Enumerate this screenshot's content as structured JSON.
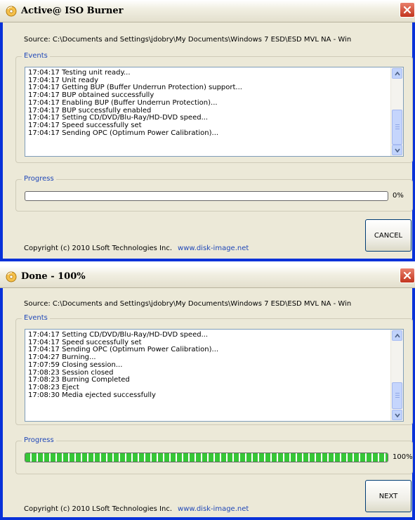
{
  "window1": {
    "title": "Active@ ISO Burner",
    "source": "Source: C:\\Documents and Settings\\jdobry\\My Documents\\Windows 7 ESD\\ESD MVL NA - Win",
    "events_label": "Events",
    "events": [
      "17:04:17 Testing unit ready...",
      "17:04:17 Unit ready",
      "17:04:17 Getting BUP (Buffer Underrun Protection) support...",
      "17:04:17 BUP obtained successfully",
      "17:04:17 Enabling BUP (Buffer Underrun Protection)...",
      "17:04:17 BUP successfully enabled",
      "17:04:17 Setting CD/DVD/Blu-Ray/HD-DVD speed...",
      "17:04:17 Speed successfully set",
      "17:04:17 Sending OPC (Optimum Power Calibration)..."
    ],
    "progress_label": "Progress",
    "progress_text": "0%",
    "progress": 0,
    "button_label": "CANCEL",
    "copyright": "Copyright (c) 2010 LSoft Technologies Inc.",
    "link": "www.disk-image.net"
  },
  "window2": {
    "title": "Done - 100%",
    "source": "Source: C:\\Documents and Settings\\jdobry\\My Documents\\Windows 7 ESD\\ESD MVL NA - Win",
    "events_label": "Events",
    "events": [
      "17:04:17 Setting CD/DVD/Blu-Ray/HD-DVD speed...",
      "17:04:17 Speed successfully set",
      "17:04:17 Sending OPC (Optimum Power Calibration)...",
      "17:04:27 Burning...",
      "17:07:59 Closing session...",
      "17:08:23 Session closed",
      "17:08:23 Burning Completed",
      "17:08:23 Eject",
      "17:08:30 Media ejected successfully"
    ],
    "progress_label": "Progress",
    "progress_text": "100%",
    "progress": 1.0,
    "button_label": "NEXT",
    "copyright": "Copyright (c) 2010 LSoft Technologies Inc.",
    "link": "www.disk-image.net"
  },
  "icons": [
    "app-icon",
    "close-icon",
    "scroll-up-icon",
    "scroll-down-icon"
  ],
  "colors": {
    "frame": "#0831d9",
    "dialog": "#ece9d8",
    "legend": "#1f47b8",
    "progress_fill": "#37c637",
    "close": "#c2351e"
  }
}
